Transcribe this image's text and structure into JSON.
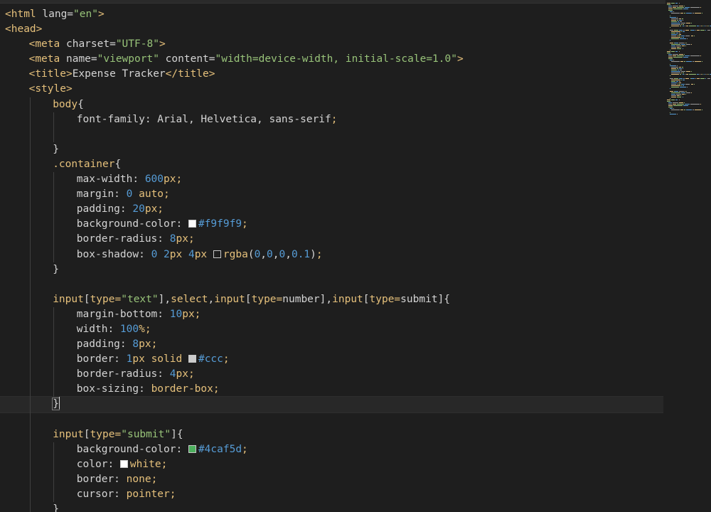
{
  "editor": {
    "language": "html",
    "accent_colors": {
      "tag": "#e5c07b",
      "string": "#98c379",
      "number": "#569cd6",
      "text": "#d4d4d4",
      "background": "#1e1e1e"
    },
    "lines": [
      {
        "indent": 0,
        "tokens": [
          [
            "tag",
            "<html "
          ],
          [
            "attr",
            "lang="
          ],
          [
            "str",
            "\"en\""
          ],
          [
            "tag",
            ">"
          ]
        ]
      },
      {
        "indent": 0,
        "tokens": [
          [
            "tag",
            "<head>"
          ]
        ]
      },
      {
        "indent": 1,
        "tokens": [
          [
            "tag",
            "<meta "
          ],
          [
            "attr",
            "charset="
          ],
          [
            "str",
            "\"UTF-8\""
          ],
          [
            "tag",
            ">"
          ]
        ]
      },
      {
        "indent": 1,
        "tokens": [
          [
            "tag",
            "<meta "
          ],
          [
            "attr",
            "name="
          ],
          [
            "str",
            "\"viewport\" "
          ],
          [
            "attr",
            "content="
          ],
          [
            "str",
            "\"width=device-width, initial-scale=1.0\""
          ],
          [
            "tag",
            ">"
          ]
        ]
      },
      {
        "indent": 1,
        "tokens": [
          [
            "tag",
            "<title>"
          ],
          [
            "attr",
            "Expense Tracker"
          ],
          [
            "tag",
            "</title>"
          ]
        ]
      },
      {
        "indent": 1,
        "tokens": [
          [
            "tag",
            "<style>"
          ]
        ]
      },
      {
        "indent": 2,
        "tokens": [
          [
            "sel",
            "body"
          ],
          [
            "brace",
            "{"
          ]
        ]
      },
      {
        "indent": 3,
        "tokens": [
          [
            "prop",
            "font-family: "
          ],
          [
            "prop",
            "Arial"
          ],
          [
            "punct",
            ", "
          ],
          [
            "prop",
            "Helvetica"
          ],
          [
            "punct",
            ", "
          ],
          [
            "prop",
            "sans-serif"
          ],
          [
            "unit",
            ";"
          ]
        ]
      },
      {
        "indent": 3,
        "tokens": []
      },
      {
        "indent": 2,
        "tokens": [
          [
            "brace",
            "}"
          ]
        ]
      },
      {
        "indent": 2,
        "tokens": [
          [
            "sel",
            ".container"
          ],
          [
            "brace",
            "{"
          ]
        ]
      },
      {
        "indent": 3,
        "tokens": [
          [
            "prop",
            "max-width: "
          ],
          [
            "num",
            "600"
          ],
          [
            "unit",
            "px;"
          ]
        ]
      },
      {
        "indent": 3,
        "tokens": [
          [
            "prop",
            "margin: "
          ],
          [
            "num",
            "0 "
          ],
          [
            "kw",
            "auto"
          ],
          [
            "unit",
            ";"
          ]
        ]
      },
      {
        "indent": 3,
        "tokens": [
          [
            "prop",
            "padding: "
          ],
          [
            "num",
            "20"
          ],
          [
            "unit",
            "px;"
          ]
        ]
      },
      {
        "indent": 3,
        "tokens": [
          [
            "prop",
            "background-color: "
          ],
          [
            "swatch",
            "#f9f9f9"
          ],
          [
            "hex",
            "#f9f9f9"
          ],
          [
            "unit",
            ";"
          ]
        ]
      },
      {
        "indent": 3,
        "tokens": [
          [
            "prop",
            "border-radius: "
          ],
          [
            "num",
            "8"
          ],
          [
            "unit",
            "px;"
          ]
        ]
      },
      {
        "indent": 3,
        "tokens": [
          [
            "prop",
            "box-shadow: "
          ],
          [
            "num",
            "0 2"
          ],
          [
            "unit",
            "px "
          ],
          [
            "num",
            "4"
          ],
          [
            "unit",
            "px "
          ],
          [
            "swatch",
            "transparent"
          ],
          [
            "kw",
            "rgba"
          ],
          [
            "punct",
            "("
          ],
          [
            "num",
            "0"
          ],
          [
            "punct",
            ","
          ],
          [
            "num",
            "0"
          ],
          [
            "punct",
            ","
          ],
          [
            "num",
            "0"
          ],
          [
            "punct",
            ","
          ],
          [
            "num",
            "0.1"
          ],
          [
            "punct",
            ")"
          ],
          [
            "unit",
            ";"
          ]
        ]
      },
      {
        "indent": 2,
        "tokens": [
          [
            "brace",
            "}"
          ]
        ]
      },
      {
        "indent": 2,
        "tokens": []
      },
      {
        "indent": 2,
        "tokens": [
          [
            "sel",
            "input"
          ],
          [
            "punct",
            "["
          ],
          [
            "sel",
            "type="
          ],
          [
            "str",
            "\"text\""
          ],
          [
            "punct",
            "],"
          ],
          [
            "sel",
            "select"
          ],
          [
            "punct",
            ","
          ],
          [
            "sel",
            "input"
          ],
          [
            "punct",
            "["
          ],
          [
            "sel",
            "type="
          ],
          [
            "prop",
            "number"
          ],
          [
            "punct",
            "],"
          ],
          [
            "sel",
            "input"
          ],
          [
            "punct",
            "["
          ],
          [
            "sel",
            "type="
          ],
          [
            "prop",
            "submit"
          ],
          [
            "punct",
            "]"
          ],
          [
            "brace",
            "{"
          ]
        ]
      },
      {
        "indent": 3,
        "tokens": [
          [
            "prop",
            "margin-bottom: "
          ],
          [
            "num",
            "10"
          ],
          [
            "unit",
            "px;"
          ]
        ]
      },
      {
        "indent": 3,
        "tokens": [
          [
            "prop",
            "width: "
          ],
          [
            "num",
            "100"
          ],
          [
            "unit",
            "%;"
          ]
        ]
      },
      {
        "indent": 3,
        "tokens": [
          [
            "prop",
            "padding: "
          ],
          [
            "num",
            "8"
          ],
          [
            "unit",
            "px;"
          ]
        ]
      },
      {
        "indent": 3,
        "tokens": [
          [
            "prop",
            "border: "
          ],
          [
            "num",
            "1"
          ],
          [
            "unit",
            "px "
          ],
          [
            "kw",
            "solid "
          ],
          [
            "swatch",
            "#cccccc"
          ],
          [
            "hex",
            "#ccc"
          ],
          [
            "unit",
            ";"
          ]
        ]
      },
      {
        "indent": 3,
        "tokens": [
          [
            "prop",
            "border-radius: "
          ],
          [
            "num",
            "4"
          ],
          [
            "unit",
            "px;"
          ]
        ]
      },
      {
        "indent": 3,
        "tokens": [
          [
            "prop",
            "box-sizing: "
          ],
          [
            "kw",
            "border-box"
          ],
          [
            "unit",
            ";"
          ]
        ]
      },
      {
        "indent": 2,
        "current": true,
        "tokens": [
          [
            "brace",
            "}"
          ],
          [
            "cursor",
            ""
          ]
        ]
      },
      {
        "indent": 2,
        "tokens": []
      },
      {
        "indent": 2,
        "tokens": [
          [
            "sel",
            "input"
          ],
          [
            "punct",
            "["
          ],
          [
            "sel",
            "type="
          ],
          [
            "str",
            "\"submit\""
          ],
          [
            "punct",
            "]"
          ],
          [
            "brace",
            "{"
          ]
        ]
      },
      {
        "indent": 3,
        "tokens": [
          [
            "prop",
            "background-color: "
          ],
          [
            "swatch",
            "#4caf5d"
          ],
          [
            "hex",
            "#4caf5d"
          ],
          [
            "unit",
            ";"
          ]
        ]
      },
      {
        "indent": 3,
        "tokens": [
          [
            "prop",
            "color: "
          ],
          [
            "swatch",
            "#ffffff"
          ],
          [
            "kw",
            "white"
          ],
          [
            "unit",
            ";"
          ]
        ]
      },
      {
        "indent": 3,
        "tokens": [
          [
            "prop",
            "border: "
          ],
          [
            "kw",
            "none"
          ],
          [
            "unit",
            ";"
          ]
        ]
      },
      {
        "indent": 3,
        "tokens": [
          [
            "prop",
            "cursor: "
          ],
          [
            "kw",
            "pointer"
          ],
          [
            "unit",
            ";"
          ]
        ]
      },
      {
        "indent": 2,
        "tokens": [
          [
            "brace",
            "}"
          ]
        ]
      }
    ]
  }
}
